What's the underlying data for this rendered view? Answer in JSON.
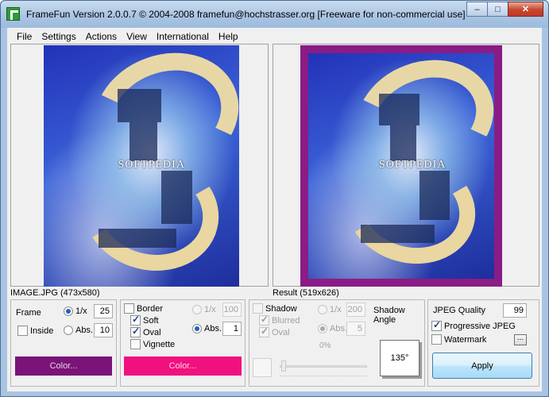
{
  "window": {
    "title": "FrameFun Version 2.0.0.7 © 2004-2008 framefun@hochstrasser.org [Freeware for non-commercial use]",
    "minimize": "–",
    "maximize": "□",
    "close": "✕"
  },
  "menu": [
    "File",
    "Settings",
    "Actions",
    "View",
    "International",
    "Help"
  ],
  "images": {
    "left_caption": "IMAGE.JPG (473x580)",
    "right_caption": "Result (519x626)",
    "art_text": "SOFTPEDIA"
  },
  "frame_group": {
    "frame_label": "Frame",
    "inv_label": "1/x",
    "inv_value": "25",
    "inside_label": "Inside",
    "abs_label": "Abs.",
    "abs_value": "10",
    "color_button": "Color...",
    "color": "#7a1478"
  },
  "border_group": {
    "border_label": "Border",
    "soft_label": "Soft",
    "oval_label": "Oval",
    "vignette_label": "Vignette",
    "inv_label": "1/x",
    "inv_value": "100",
    "abs_label": "Abs.",
    "abs_value": "1",
    "color_button": "Color...",
    "color": "#f0107e"
  },
  "shadow_group": {
    "shadow_label": "Shadow",
    "blurred_label": "Blurred",
    "oval_label": "Oval",
    "inv_label": "1/x",
    "inv_value": "200",
    "abs_label": "Abs.",
    "abs_value": "5",
    "percent": "0%",
    "angle_label": "Shadow Angle",
    "angle_value": "135°"
  },
  "output_group": {
    "jpeg_quality_label": "JPEG Quality",
    "jpeg_quality_value": "99",
    "progressive_label": "Progressive JPEG",
    "watermark_label": "Watermark",
    "more_button": "...",
    "apply_button": "Apply"
  },
  "colors": {
    "frame_purple": "#8a1c86",
    "border_magenta": "#f0107e"
  }
}
